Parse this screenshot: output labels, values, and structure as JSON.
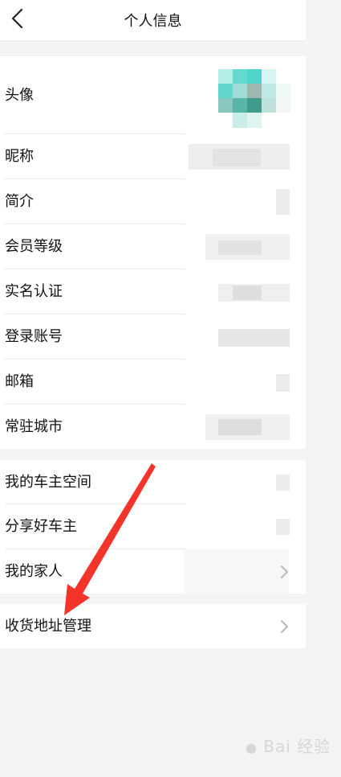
{
  "header": {
    "title": "个人信息",
    "back_icon": "back-chevron-icon"
  },
  "group1": [
    {
      "label": "头像"
    },
    {
      "label": "昵称"
    },
    {
      "label": "简介"
    },
    {
      "label": "会员等级"
    },
    {
      "label": "实名认证"
    },
    {
      "label": "登录账号"
    },
    {
      "label": "邮箱"
    },
    {
      "label": "常驻城市"
    }
  ],
  "group2": [
    {
      "label": "我的车主空间"
    },
    {
      "label": "分享好车主"
    },
    {
      "label": "我的家人"
    }
  ],
  "group3": [
    {
      "label": "收货地址管理"
    }
  ],
  "annotation": {
    "arrow_color": "#f2342a"
  },
  "watermark": {
    "text": "Bai 经验",
    "icon": "baidu-paw-icon"
  }
}
